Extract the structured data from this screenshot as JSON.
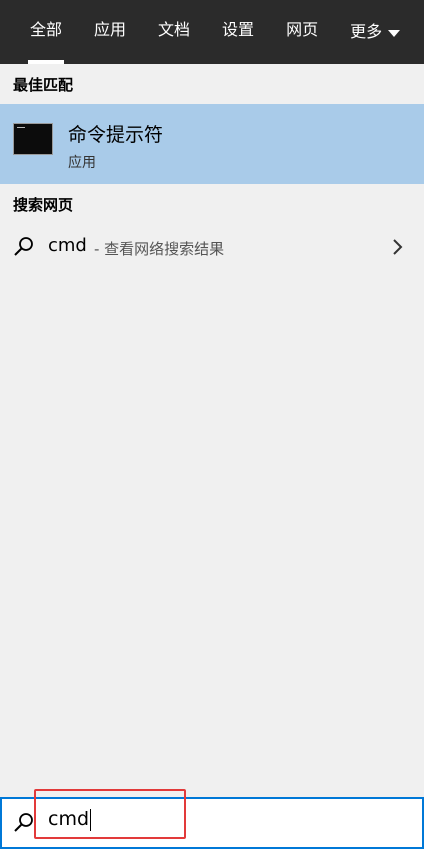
{
  "tabs": [
    {
      "label": "全部"
    },
    {
      "label": "应用"
    },
    {
      "label": "文档"
    },
    {
      "label": "设置"
    },
    {
      "label": "网页"
    },
    {
      "label": "更多"
    }
  ],
  "best_match": {
    "section_title": "最佳匹配",
    "app_name": "命令提示符",
    "app_type": "应用",
    "icon": "command-prompt-icon"
  },
  "web_search": {
    "section_title": "搜索网页",
    "query": "cmd",
    "hint": "- 查看网络搜索结果",
    "icon": "search-icon"
  },
  "search_box": {
    "value": "cmd",
    "icon": "search-icon"
  },
  "colors": {
    "tabbar_bg": "#2b2b2b",
    "selected_bg": "#a9cbe9",
    "search_border": "#0078d7",
    "annotation_red": "#e23a3a"
  }
}
